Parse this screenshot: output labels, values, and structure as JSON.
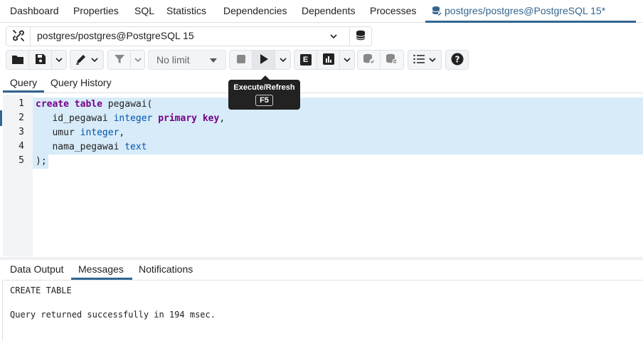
{
  "top_tabs": [
    {
      "label": "Dashboard"
    },
    {
      "label": "Properties"
    },
    {
      "label": "SQL"
    },
    {
      "label": "Statistics"
    },
    {
      "label": "Dependencies"
    },
    {
      "label": "Dependents"
    },
    {
      "label": "Processes"
    },
    {
      "label": "postgres/postgres@PostgreSQL 15*",
      "active": true
    }
  ],
  "connection": {
    "label": "postgres/postgres@PostgreSQL 15"
  },
  "toolbar": {
    "limit_label": "No limit",
    "explain_label": "E"
  },
  "tooltip": {
    "title": "Execute/Refresh",
    "shortcut": "F5"
  },
  "query_tabs": [
    {
      "label": "Query",
      "active": true
    },
    {
      "label": "Query History"
    }
  ],
  "editor": {
    "line_numbers": [
      "1",
      "2",
      "3",
      "4",
      "5"
    ],
    "lines": [
      [
        {
          "t": "create",
          "c": "kw"
        },
        {
          "t": " ",
          "c": "pn"
        },
        {
          "t": "table",
          "c": "kw"
        },
        {
          "t": " pegawai(",
          "c": "pn"
        }
      ],
      [
        {
          "t": "   id_pegawai ",
          "c": "pn"
        },
        {
          "t": "integer",
          "c": "ty"
        },
        {
          "t": " ",
          "c": "pn"
        },
        {
          "t": "primary",
          "c": "kw"
        },
        {
          "t": " ",
          "c": "pn"
        },
        {
          "t": "key",
          "c": "kw"
        },
        {
          "t": ",",
          "c": "pn"
        }
      ],
      [
        {
          "t": "   umur ",
          "c": "pn"
        },
        {
          "t": "integer",
          "c": "ty"
        },
        {
          "t": ",",
          "c": "pn"
        }
      ],
      [
        {
          "t": "   nama_pegawai ",
          "c": "pn"
        },
        {
          "t": "text",
          "c": "ty"
        }
      ],
      [
        {
          "t": ");",
          "c": "pn"
        }
      ]
    ]
  },
  "output_tabs": [
    {
      "label": "Data Output"
    },
    {
      "label": "Messages",
      "active": true
    },
    {
      "label": "Notifications"
    }
  ],
  "messages": {
    "line1": "CREATE TABLE",
    "line2": "Query returned successfully in 194 msec."
  },
  "colors": {
    "accent": "#326690",
    "selection": "#d7ebf9",
    "keyword": "#770088",
    "type": "#0055aa"
  }
}
